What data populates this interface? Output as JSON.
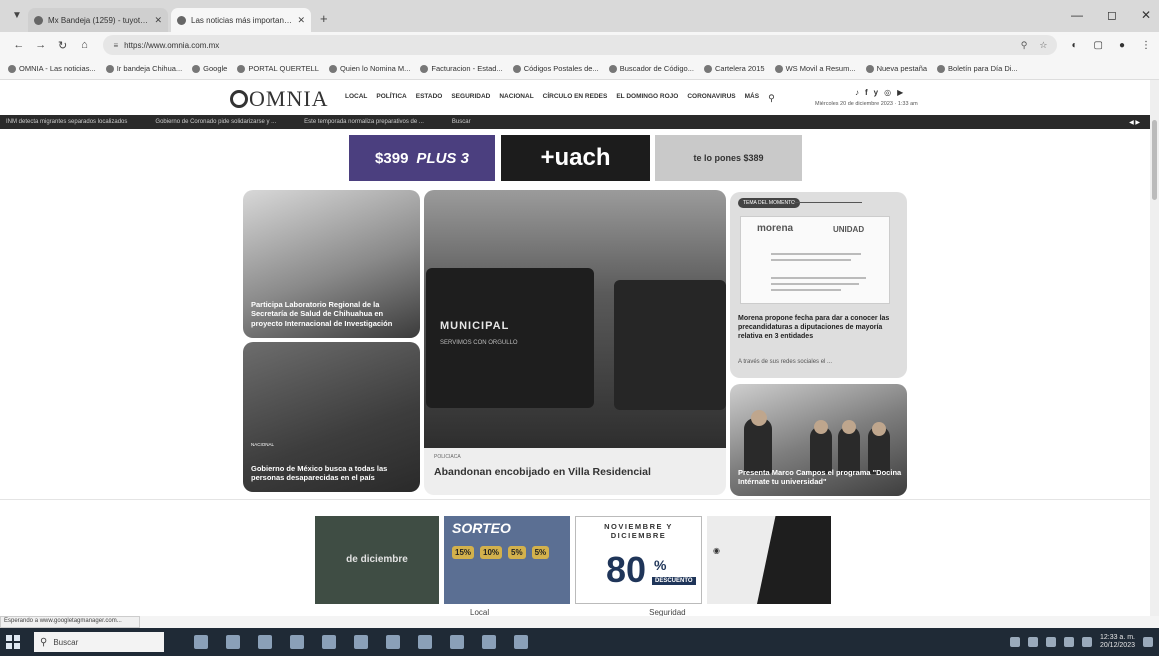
{
  "browser": {
    "tabs": [
      {
        "label": "Mx Bandeja (1259) - tuyotanoedi...",
        "active": false
      },
      {
        "label": "Las noticias más importantes d...",
        "active": true
      }
    ],
    "address": "https://www.omnia.com.mx",
    "bookmarks": [
      "OMNIA - Las noticias...",
      "Ir bandeja Chihua...",
      "Google",
      "PORTAL QUERTELL",
      "Quien lo Nomina M...",
      "Facturacion - Estad...",
      "Códigos Postales de...",
      "Buscador de Código...",
      "Cartelera 2015",
      "WS Movil a Resum...",
      "Nueva pestaña",
      "Boletín para Día Di..."
    ]
  },
  "site": {
    "logo": "OMNIA",
    "nav": [
      "LOCAL",
      "POLÍTICA",
      "ESTADO",
      "SEGURIDAD",
      "NACIONAL",
      "CÍRCULO EN REDES",
      "EL DOMINGO ROJO",
      "CORONAVIRUS",
      "MÁS"
    ],
    "social": [
      "♪",
      "f",
      "y",
      "◎",
      "▶"
    ],
    "date": "Miércoles 20 de diciembre 2023 · 1:33 am"
  },
  "ticker": {
    "items": [
      "INM detecta migrantes separados localizados",
      "Gobierno de Coronado pide solidarizarse y ...",
      "Este temporada normaliza preparativos de ..."
    ],
    "trailing": "Buscar"
  },
  "ads": {
    "top1": {
      "price": "$399",
      "plan": "PLUS 3"
    },
    "top2": {
      "brand": "+uach"
    },
    "top3": {
      "price": "$389",
      "text": "te lo pones"
    },
    "bottom1": {
      "text": "de diciembre"
    },
    "bottom2": {
      "title": "SORTEO",
      "discounts": [
        "15%",
        "10%",
        "5%",
        "5%"
      ]
    },
    "bottom3": {
      "title": "NOVIEMBRE Y DICIEMBRE",
      "big": "80",
      "pct": "%",
      "sub": "DESCUENTO"
    }
  },
  "news": {
    "story1": {
      "headline": "Participa Laboratorio Regional de la Secretaría de Salud de Chihuahua en proyecto Internacional de Investigación"
    },
    "story2": {
      "section": "NACIONAL",
      "headline": "Gobierno de México busca a todas las personas desaparecidas en el país"
    },
    "main": {
      "section": "POLICIACA",
      "headline": "Abandonan encobijado en Villa Residencial",
      "truck_label": "MUNICIPAL",
      "truck_sub": "SERVIMOS CON ORGULLO"
    },
    "story4": {
      "tag": "TEMA DEL MOMENTO",
      "doc_left": "morena",
      "doc_right": "UNIDAD",
      "headline": "Morena propone fecha para dar a conocer las precandidaturas a diputaciones de mayoría relativa en 3 entidades",
      "excerpt": "A través de sus redes sociales el ..."
    },
    "story5": {
      "headline": "Presenta Marco Campos el programa \"Docina Intérnate tu universidad\""
    }
  },
  "bottom": {
    "tabs": [
      "Local",
      "Seguridad"
    ]
  },
  "status_tip": "Esperando a www.googletagmanager.com...",
  "taskbar": {
    "search_placeholder": "Buscar",
    "clock_time": "12:33 a. m.",
    "clock_date": "20/12/2023"
  }
}
